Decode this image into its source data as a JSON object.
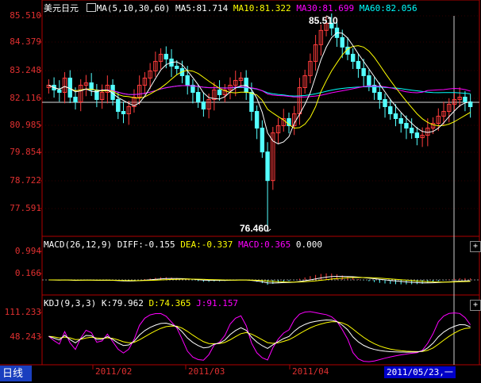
{
  "period_label": "日线",
  "cursor_date": "2011/05/23,一",
  "main_panel": {
    "title": "美元日元",
    "ma_label": "MA(5,10,30,60)",
    "ma5": "MA5:81.714",
    "ma10": "MA10:81.322",
    "ma30": "MA30:81.699",
    "ma60": "MA60:82.056",
    "high_label": "85.510",
    "low_label": "76.460",
    "y_ticks": [
      "85.510",
      "84.379",
      "83.248",
      "82.116",
      "80.985",
      "79.854",
      "78.722",
      "77.591"
    ]
  },
  "macd_panel": {
    "title": "MACD(26,12,9)",
    "diff": "DIFF:-0.155",
    "dea": "DEA:-0.337",
    "macd": "MACD:0.365",
    "zero": "0.000",
    "y_ticks": [
      "0.994",
      "0.166"
    ]
  },
  "kdj_panel": {
    "title": "KDJ(9,3,3)",
    "k": "K:79.962",
    "d": "D:74.365",
    "j": "J:91.157",
    "y_ticks": [
      "111.233",
      "48.243"
    ]
  },
  "x_ticks": [
    "2011/02",
    "2011/03",
    "2011/04"
  ],
  "colors": {
    "up": "#ff3c3c",
    "down": "#54ffff",
    "ma5": "#ffffff",
    "ma10": "#ffff00",
    "ma30": "#ff00ff",
    "ma60": "#00ffff",
    "axis": "#b00000"
  },
  "chart_data": {
    "type": "candlestick",
    "title": "美元日元",
    "y_range": [
      76.46,
      85.51
    ],
    "max_high": 85.51,
    "min_low": 76.46,
    "closes": [
      82.6,
      82.4,
      82.3,
      82.9,
      82.1,
      81.9,
      82.6,
      82.7,
      82.4,
      82.0,
      82.3,
      82.6,
      82.0,
      81.5,
      81.4,
      81.7,
      82.1,
      82.6,
      82.9,
      83.2,
      83.6,
      83.9,
      83.7,
      83.4,
      83.3,
      83.0,
      82.6,
      82.3,
      81.9,
      81.6,
      82.0,
      82.4,
      82.2,
      82.4,
      82.6,
      82.8,
      82.9,
      82.3,
      81.5,
      80.8,
      79.8,
      78.6,
      80.6,
      80.9,
      81.2,
      80.9,
      81.4,
      82.5,
      83.0,
      83.6,
      84.3,
      84.9,
      85.2,
      85.0,
      84.6,
      84.2,
      83.9,
      83.6,
      83.3,
      83.0,
      82.6,
      82.3,
      82.0,
      81.7,
      81.4,
      81.2,
      81.0,
      80.8,
      80.6,
      80.4,
      80.5,
      80.8,
      81.0,
      81.3,
      81.5,
      81.8,
      82.0,
      82.1,
      81.9,
      81.7
    ],
    "ma_values": {
      "MA5": 81.714,
      "MA10": 81.322,
      "MA30": 81.699,
      "MA60": 82.056
    },
    "macd": {
      "DIFF": -0.155,
      "DEA": -0.337,
      "MACD": 0.365,
      "y_ticks": [
        0.994,
        0.166
      ]
    },
    "kdj": {
      "K": 79.962,
      "D": 74.365,
      "J": 91.157,
      "y_ticks": [
        111.233,
        48.243
      ]
    },
    "x_ticks": [
      "2011/02",
      "2011/03",
      "2011/04"
    ]
  }
}
